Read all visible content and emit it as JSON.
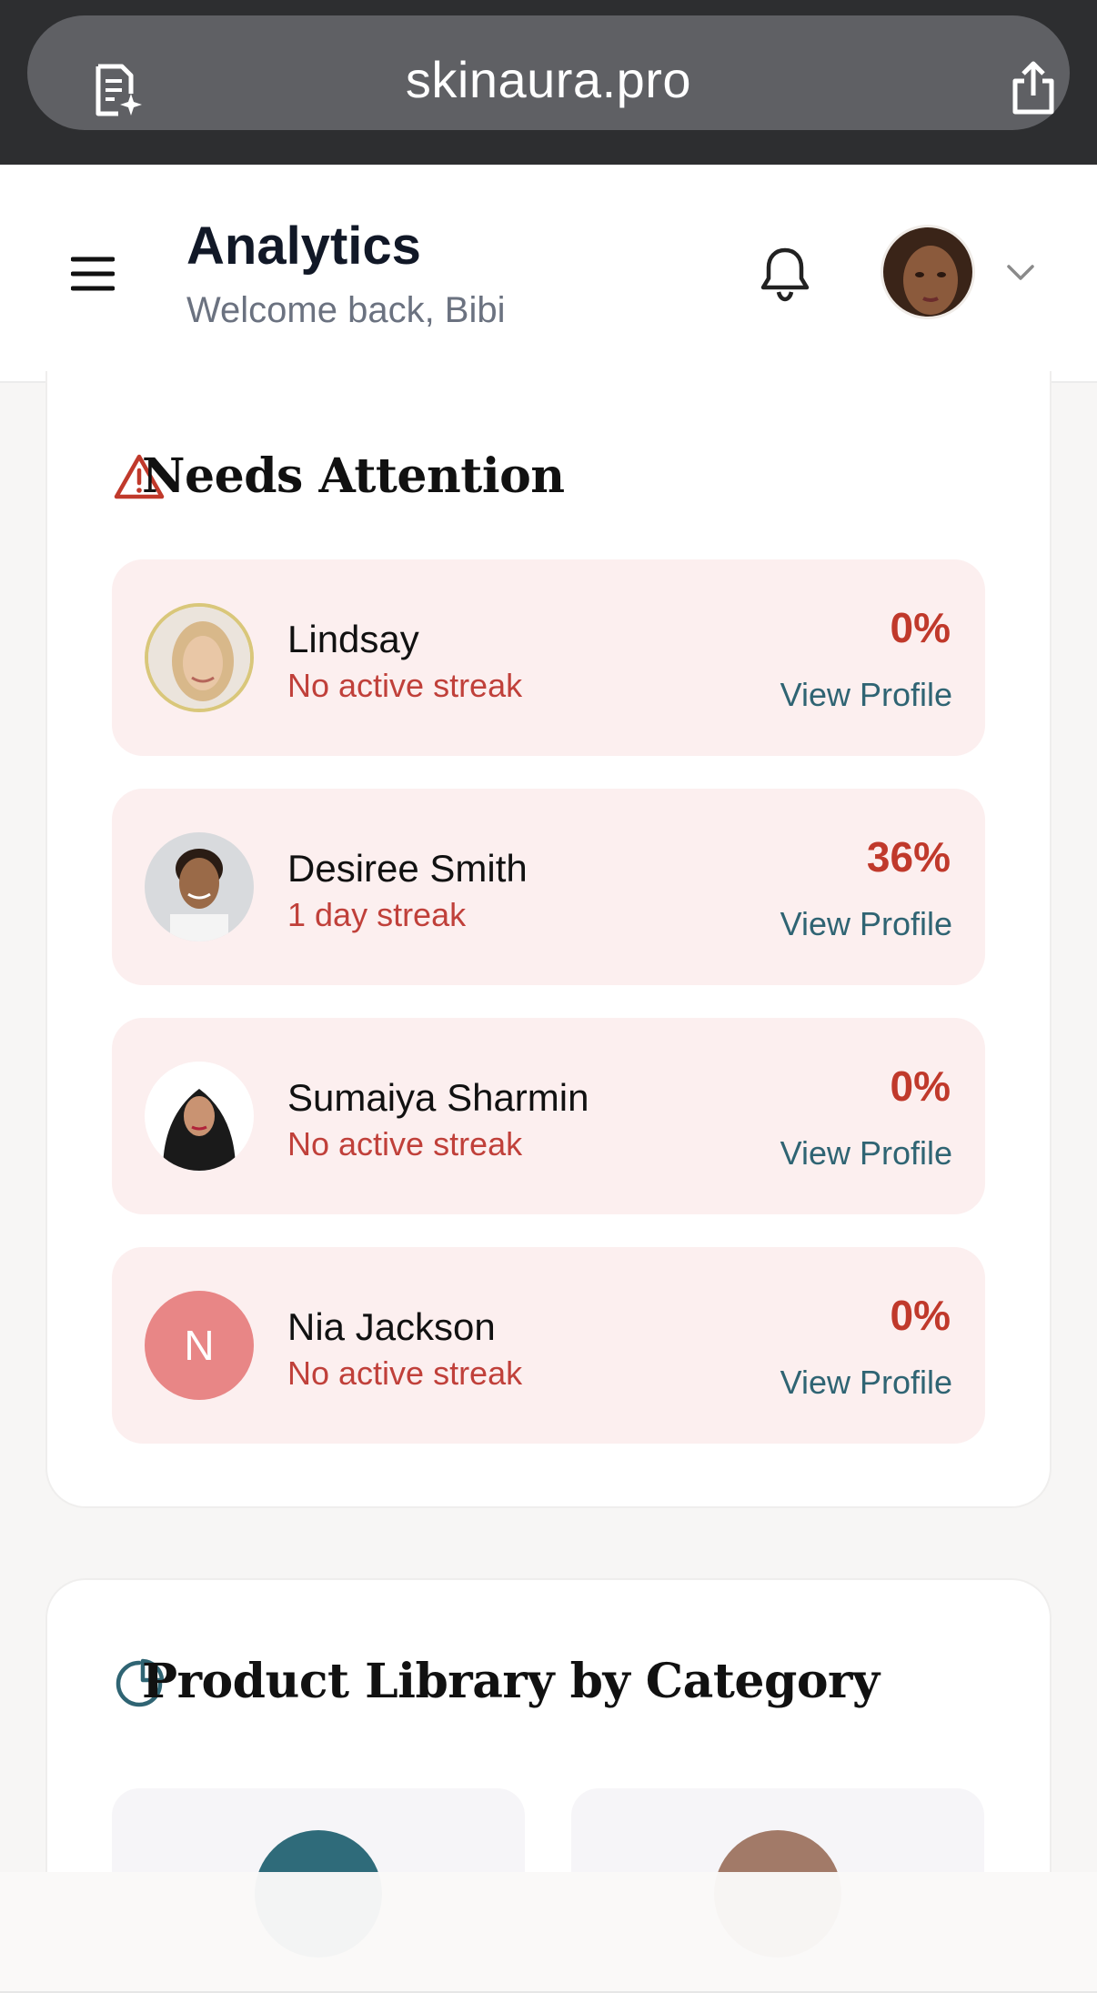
{
  "browser": {
    "url": "skinaura.pro",
    "icons": {
      "left": "reader-mode-icon",
      "right": "share-icon"
    }
  },
  "header": {
    "title": "Analytics",
    "subtitle": "Welcome back, Bibi",
    "icons": {
      "menu": "hamburger-menu-icon",
      "notifications": "bell-icon",
      "account_menu": "chevron-down-icon"
    }
  },
  "needs_attention": {
    "title": "Needs Attention",
    "icon": "warning-triangle-icon",
    "items": [
      {
        "name": "Lindsay",
        "streak": "No active streak",
        "percent": "0%",
        "link": "View Profile"
      },
      {
        "name": "Desiree Smith",
        "streak": "1 day streak",
        "percent": "36%",
        "link": "View Profile"
      },
      {
        "name": "Sumaiya Sharmin",
        "streak": "No active streak",
        "percent": "0%",
        "link": "View Profile"
      },
      {
        "name": "Nia Jackson",
        "streak": "No active streak",
        "percent": "0%",
        "link": "View Profile",
        "initial": "N"
      }
    ]
  },
  "product_library": {
    "title": "Product Library by Category",
    "icon": "pie-chart-icon"
  },
  "colors": {
    "accent_red": "#c0392b",
    "link_teal": "#2f6473",
    "row_bg": "#fcefef",
    "tile_circle_1": "#2f6b7a",
    "tile_circle_2": "#a27a68"
  }
}
